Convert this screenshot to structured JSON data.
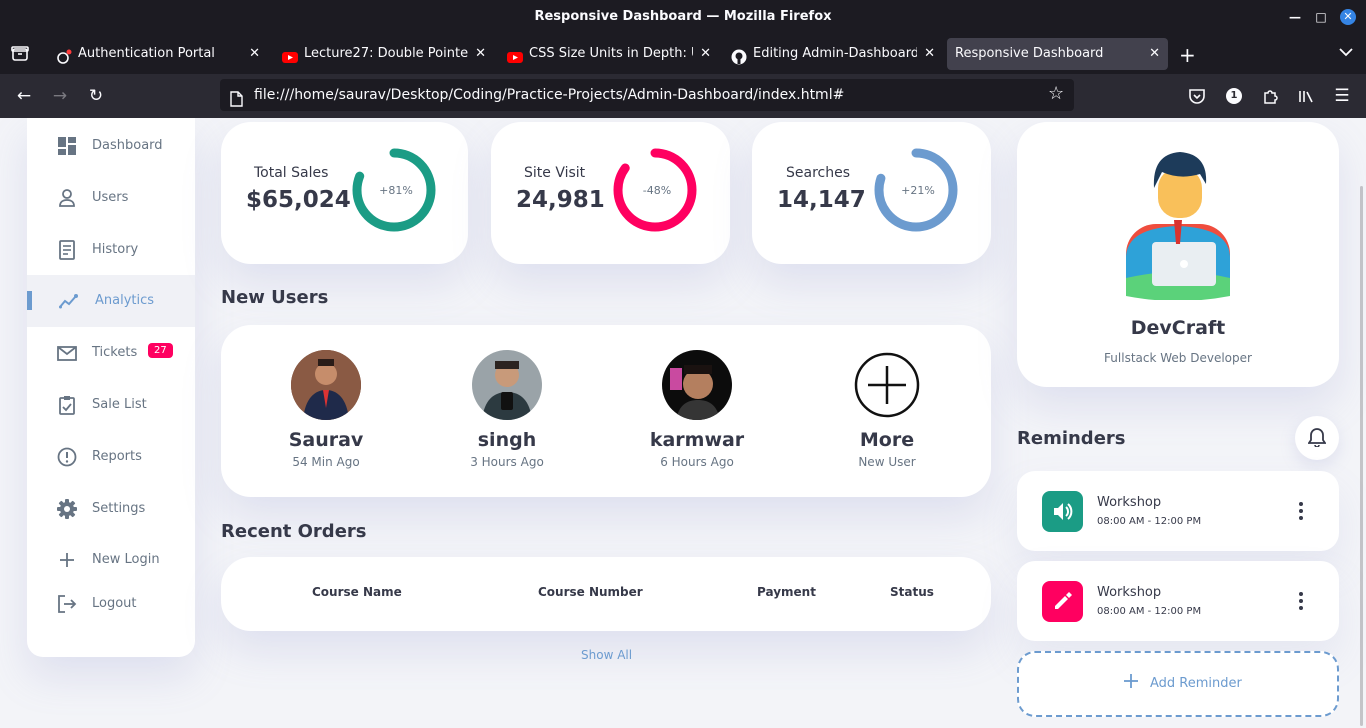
{
  "browser": {
    "window_title": "Responsive Dashboard — Mozilla Firefox",
    "tabs": [
      {
        "title": "Authentication Portal",
        "icon": "portal-icon",
        "favicon_color": "#1c1b22"
      },
      {
        "title": "Lecture27: Double Pointers",
        "icon": "youtube-icon",
        "favicon_color": "#ff0000"
      },
      {
        "title": "CSS Size Units in Depth: Unl",
        "icon": "youtube-icon",
        "favicon_color": "#ff0000"
      },
      {
        "title": "Editing Admin-Dashboard/R",
        "icon": "github-icon",
        "favicon_color": "#fbfbfe"
      },
      {
        "title": "Responsive Dashboard",
        "icon": "",
        "favicon_color": ""
      }
    ],
    "url": "file:///home/saurav/Desktop/Coding/Practice-Projects/Admin-Dashboard/index.html#",
    "extension_badge": "1"
  },
  "sidebar": {
    "items": [
      {
        "label": "Dashboard",
        "icon": "dashboard-icon"
      },
      {
        "label": "Users",
        "icon": "user-icon"
      },
      {
        "label": "History",
        "icon": "history-icon"
      },
      {
        "label": "Analytics",
        "icon": "analytics-icon",
        "active": true
      },
      {
        "label": "Tickets",
        "icon": "mail-icon",
        "badge": "27"
      },
      {
        "label": "Sale List",
        "icon": "clipboard-check-icon"
      },
      {
        "label": "Reports",
        "icon": "report-icon"
      },
      {
        "label": "Settings",
        "icon": "gear-icon"
      },
      {
        "label": "New Login",
        "icon": "plus-icon"
      },
      {
        "label": "Logout",
        "icon": "logout-icon"
      }
    ]
  },
  "stats": [
    {
      "label": "Total Sales",
      "value": "$65,024",
      "percent": "+81%",
      "progress": 0.81,
      "color": "#1b9c85"
    },
    {
      "label": "Site Visit",
      "value": "24,981",
      "percent": "-48%",
      "progress": 0.85,
      "color": "#ff0060"
    },
    {
      "label": "Searches",
      "value": "14,147",
      "percent": "+21%",
      "progress": 0.8,
      "color": "#6c9bcf"
    }
  ],
  "new_users": {
    "title": "New Users",
    "users": [
      {
        "name": "Saurav",
        "time": "54 Min Ago"
      },
      {
        "name": "singh",
        "time": "3 Hours Ago"
      },
      {
        "name": "karmwar",
        "time": "6 Hours Ago"
      },
      {
        "name": "More",
        "time": "New User"
      }
    ]
  },
  "orders": {
    "title": "Recent Orders",
    "columns": [
      "Course Name",
      "Course Number",
      "Payment",
      "Status"
    ],
    "show_all": "Show All"
  },
  "profile": {
    "name": "DevCraft",
    "role": "Fullstack Web Developer"
  },
  "reminders": {
    "title": "Reminders",
    "items": [
      {
        "title": "Workshop",
        "time": "08:00 AM - 12:00 PM",
        "icon": "volume-icon",
        "color": "#1b9c85"
      },
      {
        "title": "Workshop",
        "time": "08:00 AM - 12:00 PM",
        "icon": "edit-icon",
        "color": "#ff0060"
      }
    ],
    "add_label": "Add Reminder"
  }
}
